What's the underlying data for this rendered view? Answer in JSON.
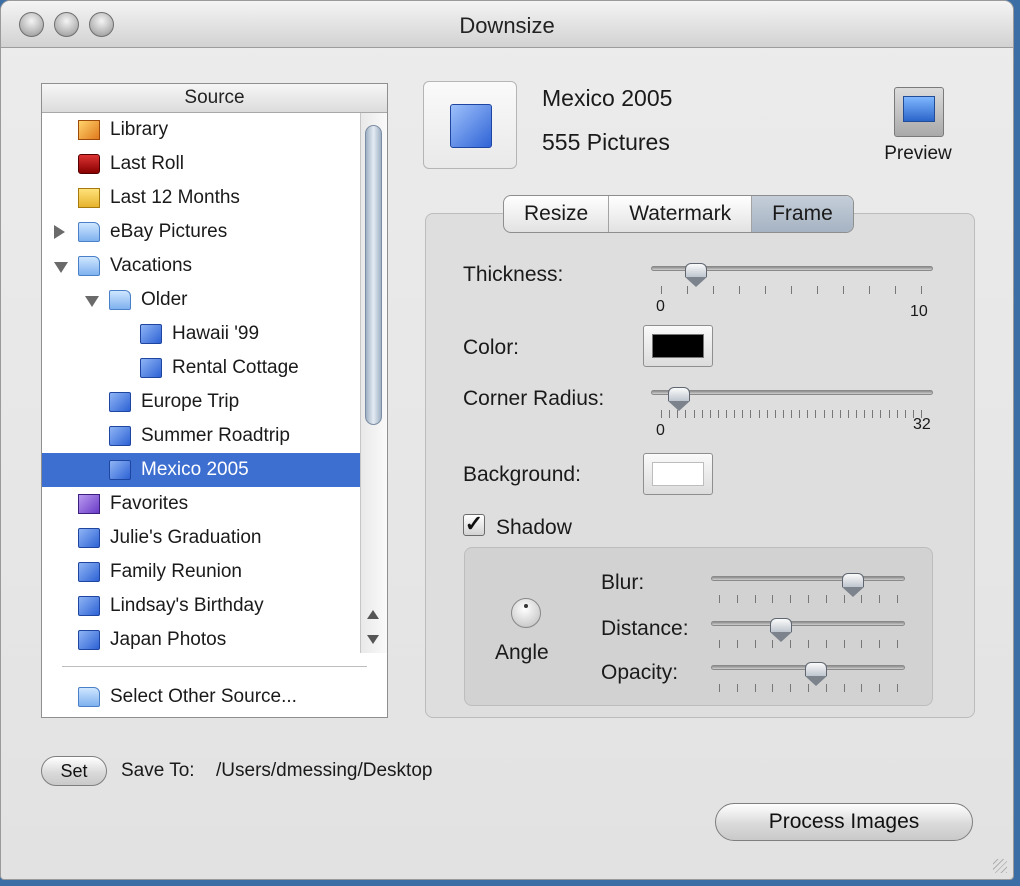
{
  "window": {
    "title": "Downsize"
  },
  "source": {
    "header": "Source",
    "items": [
      {
        "label": "Library",
        "icon": "library-icon",
        "indent": 0,
        "selected": false
      },
      {
        "label": "Last Roll",
        "icon": "film-roll-icon",
        "indent": 0,
        "selected": false
      },
      {
        "label": "Last 12 Months",
        "icon": "calendar-icon",
        "indent": 0,
        "selected": false
      },
      {
        "label": "eBay Pictures",
        "icon": "folder-icon",
        "indent": 0,
        "disclosure": "collapsed",
        "selected": false
      },
      {
        "label": "Vacations",
        "icon": "folder-icon",
        "indent": 0,
        "disclosure": "expanded",
        "selected": false
      },
      {
        "label": "Older",
        "icon": "folder-icon",
        "indent": 1,
        "disclosure": "expanded",
        "selected": false
      },
      {
        "label": "Hawaii '99",
        "icon": "album-icon",
        "indent": 2,
        "selected": false
      },
      {
        "label": "Rental Cottage",
        "icon": "album-icon",
        "indent": 2,
        "selected": false
      },
      {
        "label": "Europe Trip",
        "icon": "album-icon",
        "indent": 1,
        "selected": false
      },
      {
        "label": "Summer Roadtrip",
        "icon": "album-icon",
        "indent": 1,
        "selected": false
      },
      {
        "label": "Mexico 2005",
        "icon": "album-icon",
        "indent": 1,
        "selected": true
      },
      {
        "label": "Favorites",
        "icon": "smart-album-icon",
        "indent": 0,
        "selected": false
      },
      {
        "label": "Julie's Graduation",
        "icon": "album-icon",
        "indent": 0,
        "selected": false
      },
      {
        "label": "Family Reunion",
        "icon": "album-icon",
        "indent": 0,
        "selected": false
      },
      {
        "label": "Lindsay's Birthday",
        "icon": "album-icon",
        "indent": 0,
        "selected": false
      },
      {
        "label": "Japan Photos",
        "icon": "album-icon",
        "indent": 0,
        "selected": false
      }
    ],
    "other": "Select Other Source..."
  },
  "album": {
    "name": "Mexico 2005",
    "count": "555 Pictures"
  },
  "preview": {
    "label": "Preview"
  },
  "tabs": [
    {
      "label": "Resize",
      "active": false
    },
    {
      "label": "Watermark",
      "active": false
    },
    {
      "label": "Frame",
      "active": true
    }
  ],
  "frame": {
    "thickness": {
      "label": "Thickness:",
      "min": "0",
      "max": "10",
      "value": 1
    },
    "color": {
      "label": "Color:",
      "value": "#000000"
    },
    "corner_radius": {
      "label": "Corner Radius:",
      "min": "0",
      "max": "32",
      "value": 1
    },
    "background": {
      "label": "Background:",
      "value": "#ffffff"
    },
    "shadow": {
      "label": "Shadow",
      "checked": true,
      "angle_label": "Angle",
      "blur": {
        "label": "Blur:",
        "value": 0.79
      },
      "distance": {
        "label": "Distance:",
        "value": 0.33
      },
      "opacity": {
        "label": "Opacity:",
        "value": 0.55
      }
    }
  },
  "save": {
    "set_label": "Set",
    "label": "Save To:",
    "path": "/Users/dmessing/Desktop"
  },
  "process_label": "Process Images"
}
